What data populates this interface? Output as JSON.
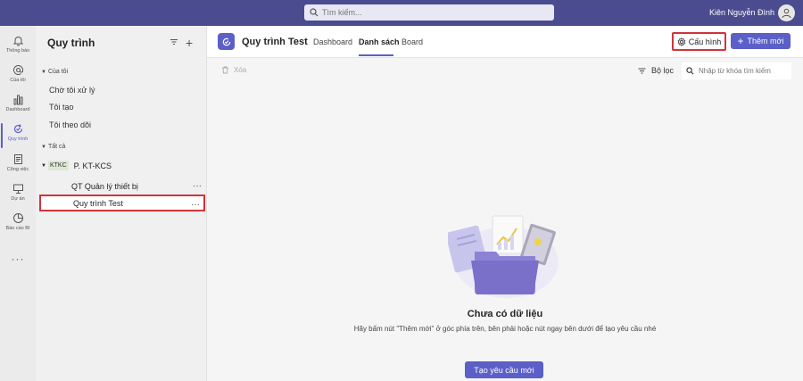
{
  "topbar": {
    "search_placeholder": "Tìm kiếm...",
    "user_name": "Kiên Nguyễn Đình"
  },
  "rail": {
    "items": [
      {
        "label": "Thông báo",
        "icon": "bell-icon"
      },
      {
        "label": "Của tôi",
        "icon": "at-icon"
      },
      {
        "label": "Dashboard",
        "icon": "chart-icon"
      },
      {
        "label": "Quy trình",
        "icon": "process-icon"
      },
      {
        "label": "Công việc",
        "icon": "task-icon"
      },
      {
        "label": "Dự án",
        "icon": "project-icon"
      },
      {
        "label": "Báo cáo BI",
        "icon": "report-icon"
      }
    ],
    "more": "···"
  },
  "sidebar": {
    "title": "Quy trình",
    "section_mine": "Của tôi",
    "mine_items": [
      "Chờ tôi xử lý",
      "Tôi tạo",
      "Tôi theo dõi"
    ],
    "section_all": "Tất cả",
    "group_badge": "KTKC",
    "group_label": "P. KT-KCS",
    "group_items": [
      "QT Quản lý thiết bị",
      "Quy trình Test"
    ],
    "more": "···"
  },
  "header": {
    "title": "Quy trình Test",
    "tabs": [
      "Dashboard",
      "Danh sách",
      "Board"
    ],
    "config_label": "Cấu hình",
    "add_label": "Thêm mới"
  },
  "toolbar": {
    "delete_label": "Xóa",
    "filter_label": "Bộ lọc",
    "keyword_placeholder": "Nhập từ khóa tìm kiếm"
  },
  "empty": {
    "title": "Chưa có dữ liệu",
    "description": "Hãy bấm nút \"Thêm mới\" ở góc phía trên, bên phải hoặc nút ngay bên dưới để tạo yêu cầu nhé",
    "button": "Tạo yêu cầu mới"
  },
  "colors": {
    "topbar": "#4b4b8f",
    "accent": "#5b5fc7",
    "highlight": "#d0343a"
  }
}
